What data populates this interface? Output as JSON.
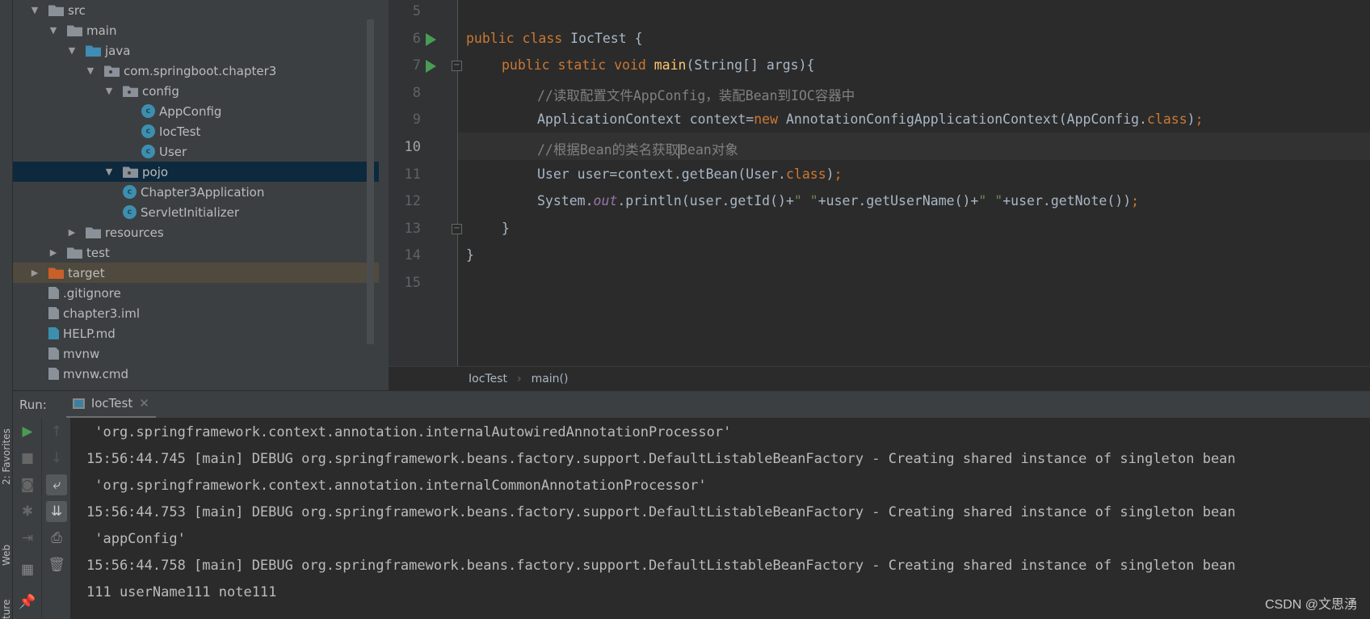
{
  "side_strip": {
    "labels": [
      "2: Favorites",
      "Web",
      "ture"
    ]
  },
  "project_tree": [
    {
      "label": "src",
      "depth": 0,
      "arrow": "down",
      "icon": "folder"
    },
    {
      "label": "main",
      "depth": 1,
      "arrow": "down",
      "icon": "folder"
    },
    {
      "label": "java",
      "depth": 2,
      "arrow": "down",
      "icon": "source-folder"
    },
    {
      "label": "com.springboot.chapter3",
      "depth": 3,
      "arrow": "down",
      "icon": "package"
    },
    {
      "label": "config",
      "depth": 4,
      "arrow": "down",
      "icon": "package"
    },
    {
      "label": "AppConfig",
      "depth": 5,
      "arrow": "",
      "icon": "class"
    },
    {
      "label": "IocTest",
      "depth": 5,
      "arrow": "",
      "icon": "class"
    },
    {
      "label": "User",
      "depth": 5,
      "arrow": "",
      "icon": "class"
    },
    {
      "label": "pojo",
      "depth": 4,
      "arrow": "down",
      "icon": "package",
      "selected": true
    },
    {
      "label": "Chapter3Application",
      "depth": 4,
      "arrow": "",
      "icon": "class"
    },
    {
      "label": "ServletInitializer",
      "depth": 4,
      "arrow": "",
      "icon": "class"
    },
    {
      "label": "resources",
      "depth": 2,
      "arrow": "right",
      "icon": "folder"
    },
    {
      "label": "test",
      "depth": 1,
      "arrow": "right",
      "icon": "folder"
    },
    {
      "label": "target",
      "depth": 0,
      "arrow": "right",
      "icon": "excluded-folder",
      "excluded": true
    },
    {
      "label": ".gitignore",
      "depth": 0,
      "arrow": "",
      "icon": "file"
    },
    {
      "label": "chapter3.iml",
      "depth": 0,
      "arrow": "",
      "icon": "file"
    },
    {
      "label": "HELP.md",
      "depth": 0,
      "arrow": "",
      "icon": "markdown-file"
    },
    {
      "label": "mvnw",
      "depth": 0,
      "arrow": "",
      "icon": "shell-file"
    },
    {
      "label": "mvnw.cmd",
      "depth": 0,
      "arrow": "",
      "icon": "file"
    }
  ],
  "editor": {
    "current_line": "10",
    "lines": [
      {
        "n": "5",
        "indent": 0,
        "tokens": []
      },
      {
        "n": "6",
        "indent": 0,
        "run": true,
        "tokens": [
          [
            "kw",
            "public class "
          ],
          [
            "",
            "IocTest {"
          ]
        ]
      },
      {
        "n": "7",
        "indent": 1,
        "run": true,
        "fold": true,
        "tokens": [
          [
            "kw",
            "public static void "
          ],
          [
            "fn",
            "main"
          ],
          [
            "",
            "(String[] args){"
          ]
        ]
      },
      {
        "n": "8",
        "indent": 2,
        "tokens": [
          [
            "cm",
            "//读取配置文件AppConfig，装配Bean到IOC容器中"
          ]
        ]
      },
      {
        "n": "9",
        "indent": 2,
        "tokens": [
          [
            "",
            "ApplicationContext context="
          ],
          [
            "kw",
            "new "
          ],
          [
            "",
            "AnnotationConfigApplicationContext(AppConfig."
          ],
          [
            "kw",
            "class"
          ],
          [
            "",
            ")"
          ],
          [
            "kw",
            ";"
          ]
        ]
      },
      {
        "n": "10",
        "indent": 2,
        "caret": true,
        "tokens": [
          [
            "cm",
            "//根据Bean的类名获取"
          ],
          [
            "cm",
            "Bean对象"
          ]
        ]
      },
      {
        "n": "11",
        "indent": 2,
        "tokens": [
          [
            "",
            "User user=context.getBean(User."
          ],
          [
            "kw",
            "class"
          ],
          [
            "",
            ")"
          ],
          [
            "kw",
            ";"
          ]
        ]
      },
      {
        "n": "12",
        "indent": 2,
        "tokens": [
          [
            "",
            "System."
          ],
          [
            "fd",
            "out"
          ],
          [
            "",
            ".println(user.getId()+"
          ],
          [
            "st",
            "\" \""
          ],
          [
            "",
            "+user.getUserName()+"
          ],
          [
            "st",
            "\" \""
          ],
          [
            "",
            "+user.getNote())"
          ],
          [
            "kw",
            ";"
          ]
        ]
      },
      {
        "n": "13",
        "indent": 1,
        "fold": true,
        "tokens": [
          [
            "",
            "}"
          ]
        ]
      },
      {
        "n": "14",
        "indent": 0,
        "tokens": [
          [
            "",
            "}"
          ]
        ]
      },
      {
        "n": "15",
        "indent": 0,
        "tokens": []
      }
    ],
    "breadcrumb": [
      "IocTest",
      "main()"
    ]
  },
  "run_panel": {
    "label": "Run:",
    "tab": "IocTest",
    "console": [
      " 'org.springframework.context.annotation.internalAutowiredAnnotationProcessor'",
      "15:56:44.745 [main] DEBUG org.springframework.beans.factory.support.DefaultListableBeanFactory - Creating shared instance of singleton bean",
      " 'org.springframework.context.annotation.internalCommonAnnotationProcessor'",
      "15:56:44.753 [main] DEBUG org.springframework.beans.factory.support.DefaultListableBeanFactory - Creating shared instance of singleton bean",
      " 'appConfig'",
      "15:56:44.758 [main] DEBUG org.springframework.beans.factory.support.DefaultListableBeanFactory - Creating shared instance of singleton bean",
      "111 userName111 note111"
    ]
  },
  "watermark": "CSDN @文思湧",
  "colors": {
    "keyword": "#cc7832",
    "comment": "#808080",
    "method": "#ffc66d",
    "string": "#6a8759",
    "field": "#9876aa",
    "run": "#499c54",
    "selection": "#0d293e"
  }
}
